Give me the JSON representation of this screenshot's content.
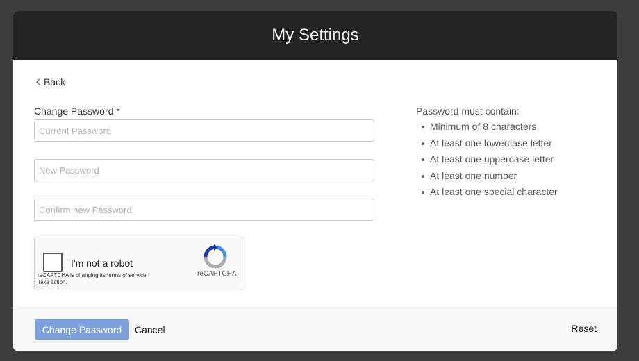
{
  "modal": {
    "title": "My Settings"
  },
  "back": {
    "label": "Back"
  },
  "form": {
    "label": "Change Password *",
    "current_password_placeholder": "Current Password",
    "new_password_placeholder": "New Password",
    "confirm_password_placeholder": "Confirm new Password"
  },
  "recaptcha": {
    "label": "I'm not a robot",
    "terms_text": "reCAPTCHA is changing its terms of service.",
    "terms_link": "Take action.",
    "brand": "reCAPTCHA"
  },
  "requirements": {
    "title": "Password must contain:",
    "items": [
      "Minimum of 8 characters",
      "At least one lowercase letter",
      "At least one uppercase letter",
      "At least one number",
      "At least one special character"
    ]
  },
  "footer": {
    "submit_label": "Change Password",
    "cancel_label": "Cancel",
    "reset_label": "Reset"
  },
  "colors": {
    "header_bg": "#232325",
    "primary_button": "#7d9fdc",
    "backdrop": "#3d3d3f"
  }
}
